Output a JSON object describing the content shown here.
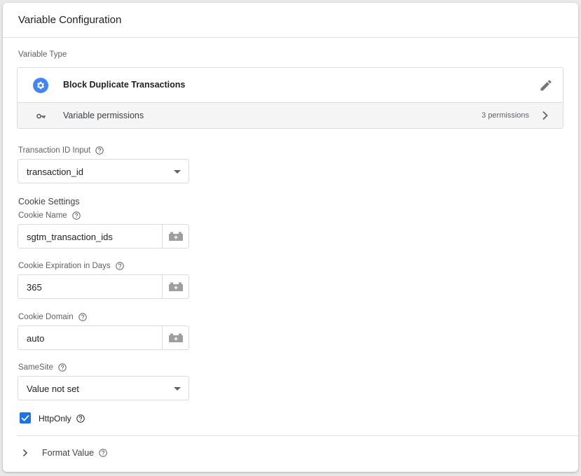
{
  "header": {
    "title": "Variable Configuration"
  },
  "variable_type": {
    "label": "Variable Type",
    "name": "Block Duplicate Transactions",
    "permissions_label": "Variable permissions",
    "permissions_count": "3 permissions",
    "icon": "gear-icon",
    "icon_color": "#4285f4"
  },
  "fields": {
    "transaction_id": {
      "label": "Transaction ID Input",
      "value": "transaction_id"
    },
    "cookie_settings_title": "Cookie Settings",
    "cookie_name": {
      "label": "Cookie Name",
      "value": "sgtm_transaction_ids"
    },
    "cookie_expiration": {
      "label": "Cookie Expiration in Days",
      "value": "365"
    },
    "cookie_domain": {
      "label": "Cookie Domain",
      "value": "auto"
    },
    "samesite": {
      "label": "SameSite",
      "value": "Value not set"
    },
    "httponly": {
      "label": "HttpOnly",
      "checked": true
    }
  },
  "format_value": {
    "label": "Format Value"
  },
  "colors": {
    "accent": "#1a73e8",
    "border": "#dadce0"
  }
}
